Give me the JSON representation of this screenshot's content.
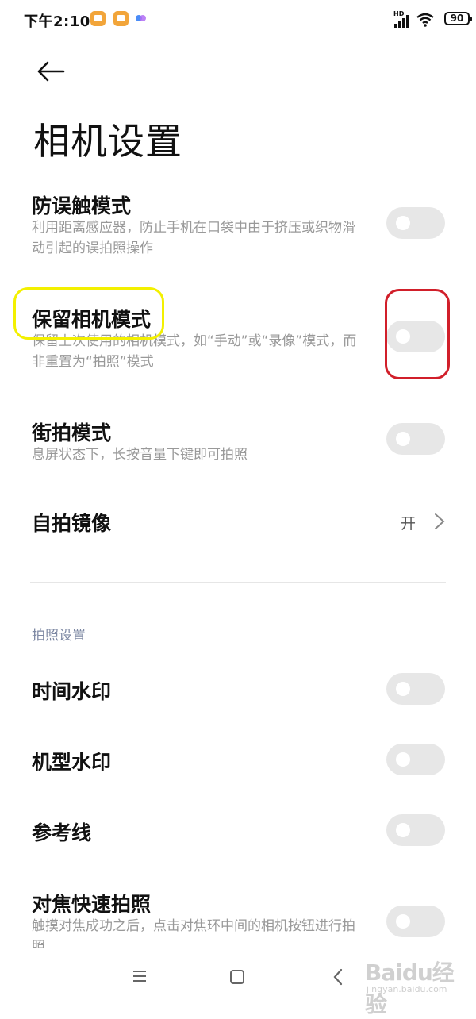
{
  "status_bar": {
    "time": "下午2:10",
    "network_label": "HD",
    "battery": "90"
  },
  "header": {
    "title": "相机设置"
  },
  "settings": [
    {
      "title": "防误触模式",
      "desc": "利用距离感应器，防止手机在口袋中由于挤压或织物滑动引起的误拍照操作",
      "enabled": false
    },
    {
      "title": "保留相机模式",
      "desc": "保留上次使用的相机模式，如“手动”或“录像”模式，而非重置为“拍照”模式",
      "enabled": false
    },
    {
      "title": "街拍模式",
      "desc": "息屏状态下，长按音量下键即可拍照",
      "enabled": false
    },
    {
      "title": "自拍镜像",
      "value": "开"
    }
  ],
  "photo_section": {
    "label": "拍照设置",
    "items": [
      {
        "title": "时间水印",
        "enabled": false
      },
      {
        "title": "机型水印",
        "enabled": false
      },
      {
        "title": "参考线",
        "enabled": false
      },
      {
        "title": "对焦快速拍照",
        "desc": "触摸对焦成功之后，点击对焦环中间的相机按钮进行拍照",
        "enabled": false
      }
    ]
  },
  "watermark": {
    "brand": "Baidu经验",
    "url": "jingyan.baidu.com"
  },
  "colors": {
    "toggle_off": "#e7e7e7",
    "section_label": "#7d88a3",
    "annotation_yellow": "#f3f000",
    "annotation_red": "#d11f2a"
  }
}
